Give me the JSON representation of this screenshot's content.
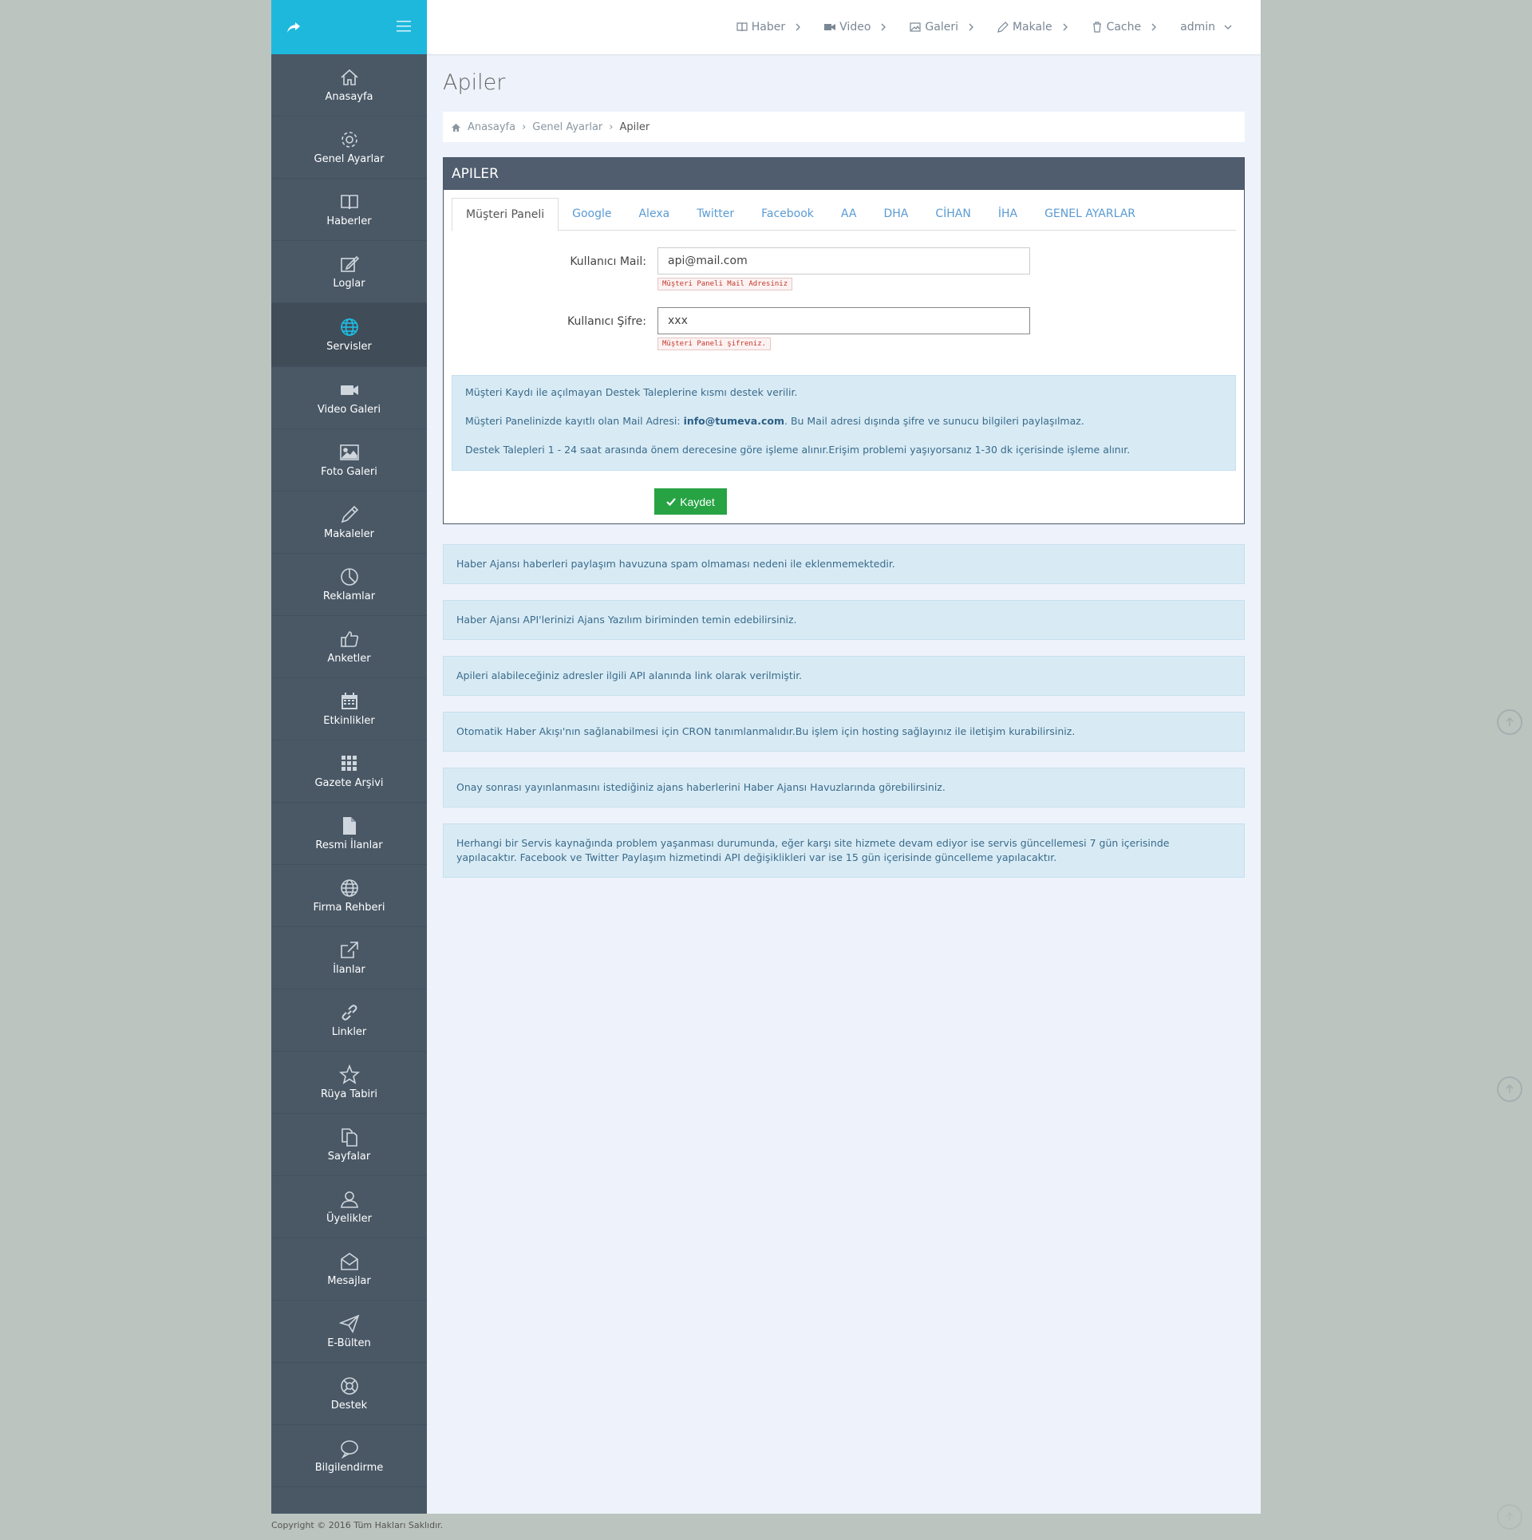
{
  "sidebar": {
    "items": [
      {
        "label": "Anasayfa",
        "icon": "home-icon"
      },
      {
        "label": "Genel Ayarlar",
        "icon": "gear-icon"
      },
      {
        "label": "Haberler",
        "icon": "book-icon"
      },
      {
        "label": "Loglar",
        "icon": "edit-icon"
      },
      {
        "label": "Servisler",
        "icon": "globe-icon"
      },
      {
        "label": "Video Galeri",
        "icon": "video-icon"
      },
      {
        "label": "Foto Galeri",
        "icon": "image-icon"
      },
      {
        "label": "Makaleler",
        "icon": "pencil-icon"
      },
      {
        "label": "Reklamlar",
        "icon": "pie-icon"
      },
      {
        "label": "Anketler",
        "icon": "thumbs-up-icon"
      },
      {
        "label": "Etkinlikler",
        "icon": "calendar-icon"
      },
      {
        "label": "Gazete Arşivi",
        "icon": "grid-icon"
      },
      {
        "label": "Resmi İlanlar",
        "icon": "file-icon"
      },
      {
        "label": "Firma Rehberi",
        "icon": "globe-icon"
      },
      {
        "label": "İlanlar",
        "icon": "share-square-icon"
      },
      {
        "label": "Linkler",
        "icon": "link-icon"
      },
      {
        "label": "Rüya Tabiri",
        "icon": "star-icon"
      },
      {
        "label": "Sayfalar",
        "icon": "copy-icon"
      },
      {
        "label": "Üyelikler",
        "icon": "user-icon"
      },
      {
        "label": "Mesajlar",
        "icon": "mail-icon"
      },
      {
        "label": "E-Bülten",
        "icon": "send-icon"
      },
      {
        "label": "Destek",
        "icon": "lifebuoy-icon"
      },
      {
        "label": "Bilgilendirme",
        "icon": "comment-icon"
      }
    ]
  },
  "topnav": {
    "haber": "Haber",
    "video": "Video",
    "galeri": "Galeri",
    "makale": "Makale",
    "cache": "Cache",
    "user": "admin"
  },
  "page": {
    "title": "Apiler",
    "breadcrumb": [
      "Anasayfa",
      "Genel Ayarlar",
      "Apiler"
    ]
  },
  "panel": {
    "title": "APILER",
    "tabs": [
      "Müşteri Paneli",
      "Google",
      "Alexa",
      "Twitter",
      "Facebook",
      "AA",
      "DHA",
      "CİHAN",
      "İHA",
      "GENEL AYARLAR"
    ],
    "form": {
      "mail_label": "Kullanıcı Mail:",
      "mail_value": "api@mail.com",
      "mail_hint": "Müşteri Paneli Mail Adresiniz",
      "pass_label": "Kullanıcı Şifre:",
      "pass_value": "xxx",
      "pass_hint": "Müşteri Paneli şifreniz."
    },
    "info": {
      "line1": "Müşteri Kaydı ile açılmayan Destek Taleplerine kısmı destek verilir.",
      "line2_prefix": "Müşteri Panelinizde kayıtlı olan Mail Adresi: ",
      "line2_email": "info@tumeva.com",
      "line2_suffix": ". Bu Mail adresi dışında şifre ve sunucu bilgileri paylaşılmaz.",
      "line3": "Destek Talepleri 1 - 24 saat arasında önem derecesine göre işleme alınır.Erişim problemi yaşıyorsanız 1-30 dk içerisinde işleme alınır."
    },
    "save_label": "Kaydet"
  },
  "alerts": [
    "Haber Ajansı haberleri paylaşım havuzuna spam olmaması nedeni ile eklenmemektedir.",
    "Haber Ajansı API'lerinizi Ajans Yazılım biriminden temin edebilirsiniz.",
    "Apileri alabileceğiniz adresler ilgili API alanında link olarak verilmiştir.",
    "Otomatik Haber Akışı'nın sağlanabilmesi için CRON tanımlanmalıdır.Bu işlem için hosting sağlayınız ile iletişim kurabilirsiniz.",
    "Onay sonrası yayınlanmasını istediğiniz ajans haberlerini Haber Ajansı Havuzlarında görebilirsiniz.",
    "Herhangi bir Servis kaynağında problem yaşanması durumunda, eğer karşı site hizmete devam ediyor ise servis güncellemesi 7 gün içerisinde yapılacaktır. Facebook ve Twitter Paylaşım hizmetindi API değişiklikleri var ise 15 gün içerisinde güncelleme yapılacaktır."
  ],
  "footer": "Copyright © 2016 Tüm Hakları Saklıdır."
}
